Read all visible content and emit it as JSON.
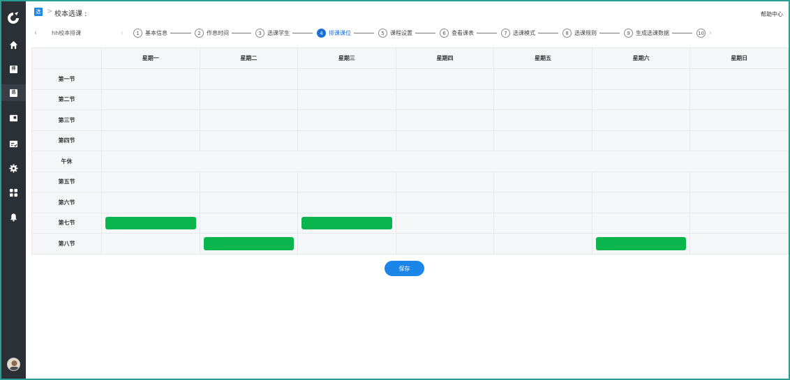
{
  "header": {
    "app_badge": "选",
    "breadcrumb_sep": ">",
    "title": "校本选课 :",
    "help_label": "帮助中心"
  },
  "sidebar": {
    "items": [
      {
        "name": "home-icon"
      },
      {
        "name": "schedule-icon",
        "glyph": "排"
      },
      {
        "name": "course-select-icon",
        "glyph": "选",
        "active": true
      },
      {
        "name": "book-icon"
      },
      {
        "name": "evaluation-icon"
      },
      {
        "name": "settings-icon"
      },
      {
        "name": "apps-icon"
      },
      {
        "name": "bell-icon"
      }
    ]
  },
  "steps_bar": {
    "back_icon": "‹",
    "plan_name": "hh校本排课",
    "left_chevron": "‹",
    "right_chevron": "›",
    "steps": [
      {
        "num": "1",
        "label": "基本信息"
      },
      {
        "num": "2",
        "label": "作息时间"
      },
      {
        "num": "3",
        "label": "选课学生"
      },
      {
        "num": "4",
        "label": "排课课位",
        "active": true
      },
      {
        "num": "5",
        "label": "课程设置"
      },
      {
        "num": "6",
        "label": "查看课表"
      },
      {
        "num": "7",
        "label": "选课模式"
      },
      {
        "num": "8",
        "label": "选课规则"
      },
      {
        "num": "9",
        "label": "生成选课数据"
      },
      {
        "num": "10",
        "label": ""
      }
    ]
  },
  "timetable": {
    "corner": "",
    "days": [
      "星期一",
      "星期二",
      "星期三",
      "星期四",
      "星期五",
      "星期六",
      "星期日"
    ],
    "periods": [
      "第一节",
      "第二节",
      "第三节",
      "第四节",
      "午休",
      "第五节",
      "第六节",
      "第七节",
      "第八节"
    ],
    "selected_slots": [
      {
        "period": "第七节",
        "day": "星期一"
      },
      {
        "period": "第七节",
        "day": "星期三"
      },
      {
        "period": "第八节",
        "day": "星期二"
      },
      {
        "period": "第八节",
        "day": "星期六"
      }
    ],
    "selected_color": "#0bb54e"
  },
  "actions": {
    "save_label": "保存"
  },
  "colors": {
    "sidebar_bg": "#2b2f36",
    "accent": "#1a6fd6",
    "frame": "#2a9d95"
  }
}
